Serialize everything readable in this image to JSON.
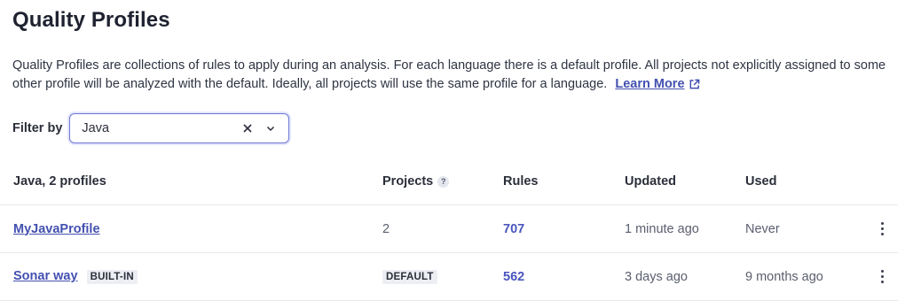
{
  "page": {
    "title": "Quality Profiles",
    "description": "Quality Profiles are collections of rules to apply during an analysis. For each language there is a default profile. All projects not explicitly assigned to some other profile will be analyzed with the default. Ideally, all projects will use the same profile for a language.",
    "learn_more": "Learn More"
  },
  "filter": {
    "label": "Filter by",
    "value": "Java"
  },
  "table": {
    "group_header": "Java, 2 profiles",
    "columns": {
      "projects": "Projects",
      "projects_help": "?",
      "rules": "Rules",
      "updated": "Updated",
      "used": "Used"
    },
    "rows": [
      {
        "name": "MyJavaProfile",
        "badge": "",
        "projects": "2",
        "rules": "707",
        "updated": "1 minute ago",
        "used": "Never"
      },
      {
        "name": "Sonar way",
        "badge": "BUILT-IN",
        "projects": "DEFAULT",
        "rules": "562",
        "updated": "3 days ago",
        "used": "9 months ago"
      }
    ]
  },
  "icons": {
    "external_link": "external-link-icon",
    "clear": "close-icon",
    "dropdown": "chevron-down-icon",
    "actions": "more-vertical-icon"
  },
  "colors": {
    "accent": "#4350b0",
    "border": "#e6e8ee"
  }
}
